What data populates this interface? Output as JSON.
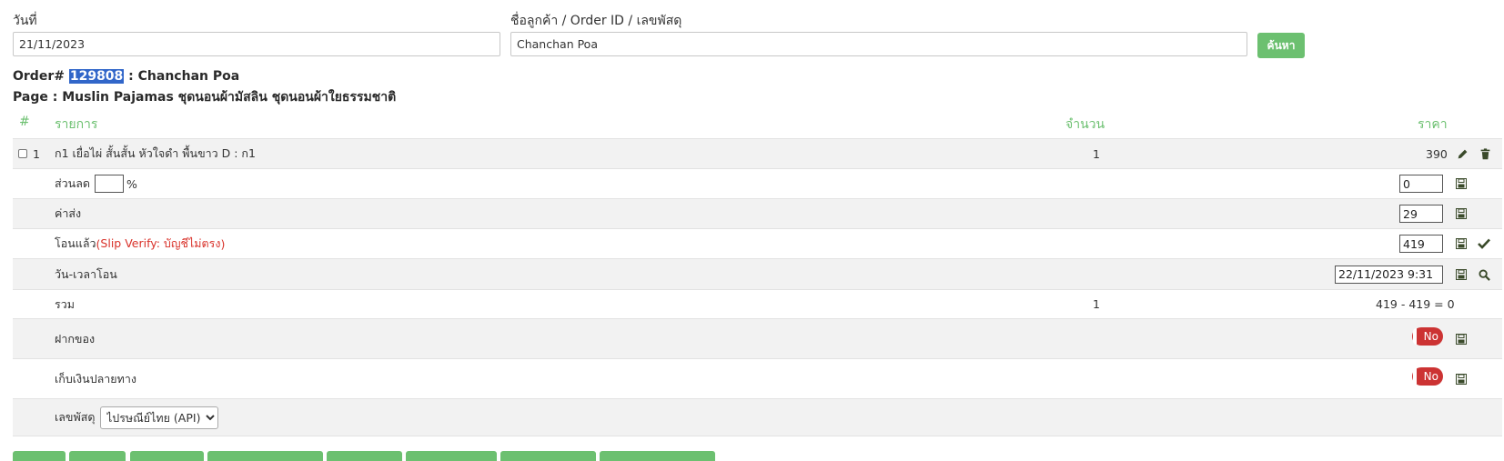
{
  "search": {
    "date_label": "วันที่",
    "date_value": "21/11/2023",
    "customer_label": "ชื่อลูกค้า / Order ID / เลขพัสดุ",
    "customer_value": "Chanchan Poa",
    "search_button": "ค้นหา"
  },
  "order": {
    "prefix": "Order# ",
    "id": "129808",
    "customer": " : Chanchan Poa",
    "page_line": "Page : Muslin Pajamas ชุดนอนผ้ามัสลิน ชุดนอนผ้าใยธรรมชาติ"
  },
  "table": {
    "headers": {
      "index": "#",
      "item": "รายการ",
      "qty": "จำนวน",
      "price": "ราคา"
    },
    "item": {
      "index": "1",
      "name": "ก1 เยื่อไผ่ สั้นสั้น หัวใจดำ พื้นขาว D : ก1",
      "qty": "1",
      "price": "390"
    },
    "discount": {
      "label": "ส่วนลด",
      "percent_value": "",
      "percent_sign": "%",
      "value": "0"
    },
    "shipping": {
      "label": "ค่าส่ง",
      "value": "29"
    },
    "paid": {
      "label": "โอนแล้ว",
      "note_open": " (",
      "note": "Slip Verify: บัญชีไม่ตรง",
      "note_close": ")",
      "value": "419"
    },
    "transfer_time": {
      "label": "วัน-เวลาโอน",
      "value": "22/11/2023 9:31"
    },
    "total": {
      "label": "รวม",
      "qty": "1",
      "formula": "419 - 419 = 0"
    },
    "deposit": {
      "label": "ฝากของ",
      "toggle": "No"
    },
    "cod": {
      "label": "เก็บเงินปลายทาง",
      "toggle": "No"
    },
    "tracking": {
      "label": "เลขพัสดุ",
      "carrier": "ไปรษณีย์ไทย (API)"
    }
  },
  "colors": {
    "accent": "#6cc070",
    "danger": "#cc3333",
    "selection": "#3166c9"
  },
  "icons": {
    "edit": "pencil-icon",
    "delete": "trash-icon",
    "save": "save-icon",
    "verify": "check-icon",
    "search": "search-icon"
  }
}
